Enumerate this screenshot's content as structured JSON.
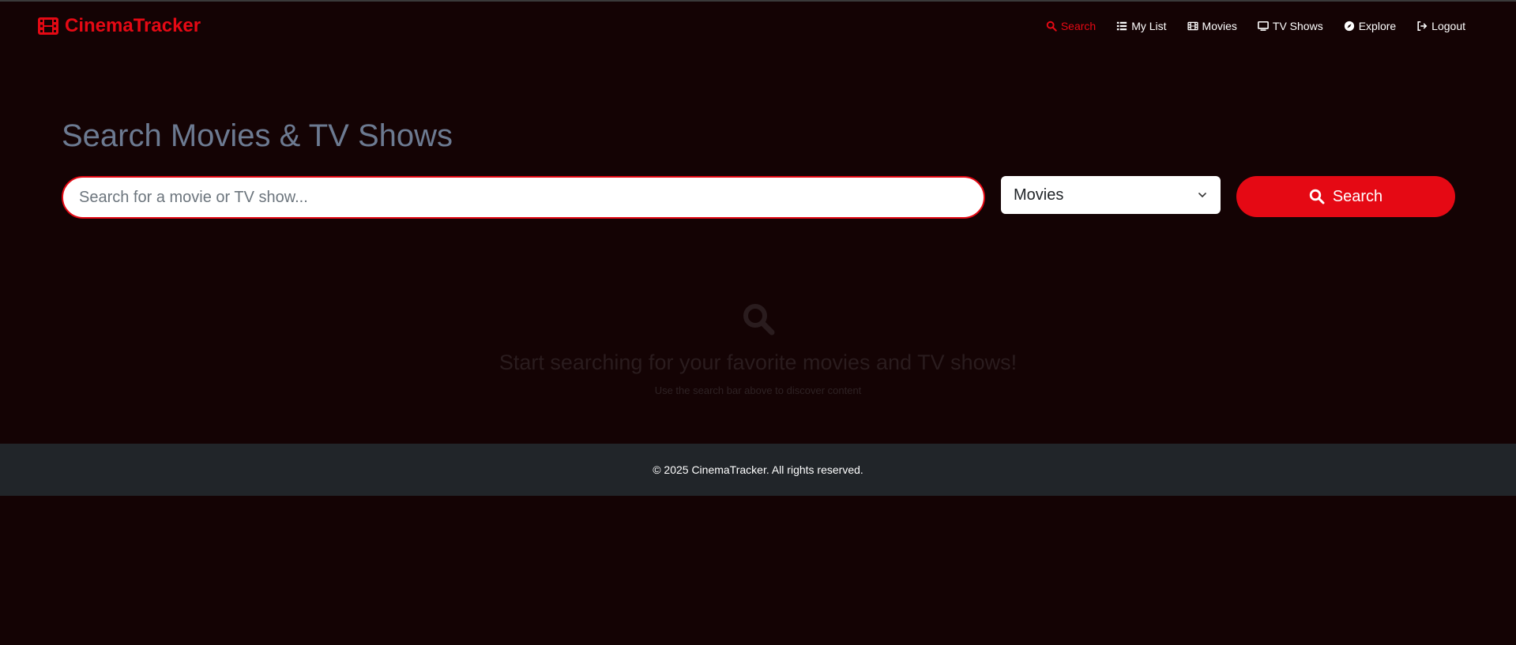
{
  "brand": {
    "name": "CinemaTracker",
    "icon": "film-icon",
    "color": "#e50914"
  },
  "nav": {
    "items": [
      {
        "label": "Search",
        "icon": "search-icon",
        "active": true
      },
      {
        "label": "My List",
        "icon": "list-icon",
        "active": false
      },
      {
        "label": "Movies",
        "icon": "film-icon",
        "active": false
      },
      {
        "label": "TV Shows",
        "icon": "tv-icon",
        "active": false
      },
      {
        "label": "Explore",
        "icon": "compass-icon",
        "active": false
      },
      {
        "label": "Logout",
        "icon": "logout-icon",
        "active": false
      }
    ]
  },
  "main": {
    "title": "Search Movies & TV Shows",
    "search": {
      "placeholder": "Search for a movie or TV show...",
      "value": ""
    },
    "type_select": {
      "selected": "Movies"
    },
    "search_button": {
      "label": "Search"
    }
  },
  "empty_state": {
    "icon": "search-icon",
    "title": "Start searching for your favorite movies and TV shows!",
    "subtitle": "Use the search bar above to discover content"
  },
  "footer": {
    "text": "© 2025 CinemaTracker. All rights reserved."
  },
  "colors": {
    "accent": "#e50914",
    "background": "#140304",
    "footer": "#212529",
    "title": "#6c7a91"
  }
}
